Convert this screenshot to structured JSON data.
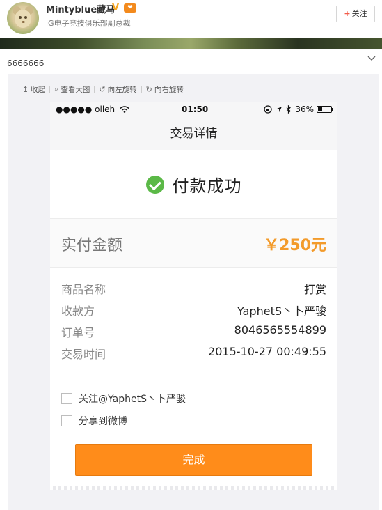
{
  "post": {
    "username": "Mintyblue藏马",
    "verified_mark": "V",
    "vip_label": "❤",
    "description": "iG电子竞技俱乐部副总裁",
    "follow_label": "关注",
    "follow_plus": "+",
    "text": "6666666"
  },
  "viewer": {
    "toolbar": [
      {
        "icon": "↥",
        "label": "收起"
      },
      {
        "icon": "⌕",
        "label": "查看大图"
      },
      {
        "icon": "↺",
        "label": "向左旋转"
      },
      {
        "icon": "↻",
        "label": "向右旋转"
      }
    ]
  },
  "phone": {
    "status": {
      "carrier": "●●●●● olleh",
      "time": "01:50",
      "battery_pct": "36%",
      "battery_level": 0.36
    },
    "nav_title": "交易详情",
    "success_text": "付款成功",
    "amount": {
      "label": "实付金额",
      "value": "￥250元"
    },
    "details": [
      {
        "label": "商品名称",
        "value": "打赏"
      },
      {
        "label": "收款方",
        "value": "YaphetS丶卜严骏"
      },
      {
        "label": "订单号",
        "value": "8046565554899"
      },
      {
        "label": "交易时间",
        "value": "2015-10-27 00:49:55"
      }
    ],
    "options": [
      {
        "label": "关注@YaphetS丶卜严骏",
        "checked": false
      },
      {
        "label": "分享到微博",
        "checked": false
      }
    ],
    "done_label": "完成"
  },
  "colors": {
    "accent_orange": "#ff8c1a",
    "amount_orange": "#f39b2b",
    "success_green": "#5bb947"
  }
}
